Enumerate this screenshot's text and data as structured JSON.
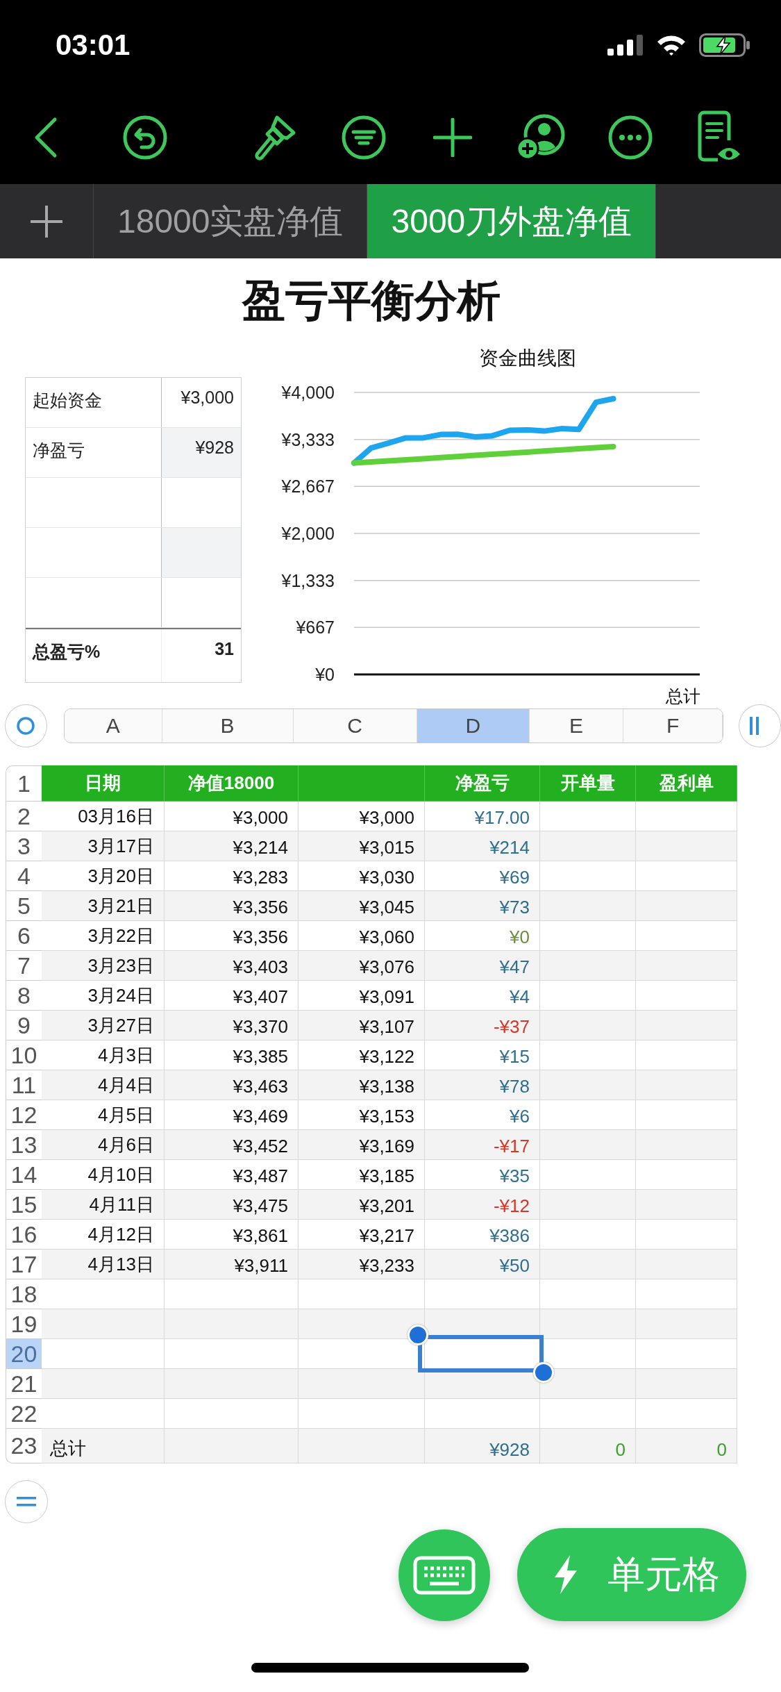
{
  "status_bar": {
    "time": "03:01"
  },
  "sheet_tabs": [
    {
      "label": "18000实盘净值",
      "selected": false
    },
    {
      "label": "3000刀外盘净值",
      "selected": true
    }
  ],
  "title": "盈亏平衡分析",
  "summary": {
    "rows": [
      {
        "label": "起始资金",
        "value": "¥3,000"
      },
      {
        "label": "净盈亏",
        "value": "¥928"
      }
    ],
    "total": {
      "label": "总盈亏%",
      "value": "31"
    }
  },
  "chart": {
    "chart_data": {
      "type": "line",
      "title": "资金曲线图",
      "xlabel": "总计",
      "grid": true,
      "ylim": [
        0,
        4000
      ],
      "yticks": [
        {
          "value": 0,
          "label": "¥0"
        },
        {
          "value": 667,
          "label": "¥667"
        },
        {
          "value": 1333,
          "label": "¥1,333"
        },
        {
          "value": 2000,
          "label": "¥2,000"
        },
        {
          "value": 2667,
          "label": "¥2,667"
        },
        {
          "value": 3333,
          "label": "¥3,333"
        },
        {
          "value": 4000,
          "label": "¥4,000"
        }
      ],
      "series": [
        {
          "color": "#1ea5f0",
          "values": [
            3000,
            3214,
            3283,
            3356,
            3356,
            3403,
            3407,
            3370,
            3385,
            3463,
            3469,
            3452,
            3487,
            3475,
            3861,
            3911,
            null,
            null,
            null,
            null,
            null
          ]
        },
        {
          "color": "#5fd03a",
          "values": [
            3000,
            3015,
            3030,
            3045,
            3060,
            3076,
            3091,
            3107,
            3122,
            3138,
            3153,
            3169,
            3185,
            3201,
            3217,
            3233,
            null,
            null,
            null,
            null,
            null
          ]
        }
      ]
    }
  },
  "sheet": {
    "columns": [
      {
        "label": "A",
        "selected": false,
        "header": "日期"
      },
      {
        "label": "B",
        "selected": false,
        "header": "净值18000"
      },
      {
        "label": "C",
        "selected": false
      },
      {
        "label": "D",
        "selected": true,
        "header": "净盈亏"
      },
      {
        "label": "E",
        "selected": false,
        "header": "开单量"
      },
      {
        "label": "F",
        "selected": false,
        "header": "盈利单"
      }
    ],
    "row_numbers": [
      {
        "label": "1",
        "selected": false
      },
      {
        "label": "2",
        "selected": false
      },
      {
        "label": "3",
        "selected": false
      },
      {
        "label": "4",
        "selected": false
      },
      {
        "label": "5",
        "selected": false
      },
      {
        "label": "6",
        "selected": false
      },
      {
        "label": "7",
        "selected": false
      },
      {
        "label": "8",
        "selected": false
      },
      {
        "label": "9",
        "selected": false
      },
      {
        "label": "10",
        "selected": false
      },
      {
        "label": "11",
        "selected": false
      },
      {
        "label": "12",
        "selected": false
      },
      {
        "label": "13",
        "selected": false
      },
      {
        "label": "14",
        "selected": false
      },
      {
        "label": "15",
        "selected": false
      },
      {
        "label": "16",
        "selected": false
      },
      {
        "label": "17",
        "selected": false
      },
      {
        "label": "18",
        "selected": false
      },
      {
        "label": "19",
        "selected": false
      },
      {
        "label": "20",
        "selected": true
      },
      {
        "label": "21",
        "selected": false
      },
      {
        "label": "22",
        "selected": false
      },
      {
        "label": "23",
        "selected": false
      }
    ],
    "rows": [
      {
        "date": "03月16日",
        "net": "¥3,000",
        "baseline": "¥3,000",
        "pnl": "¥17.00",
        "color": "#2e6e8e"
      },
      {
        "date": "3月17日",
        "net": "¥3,214",
        "baseline": "¥3,015",
        "pnl": "¥214",
        "color": "#2e6e8e"
      },
      {
        "date": "3月20日",
        "net": "¥3,283",
        "baseline": "¥3,030",
        "pnl": "¥69",
        "color": "#2e6e8e"
      },
      {
        "date": "3月21日",
        "net": "¥3,356",
        "baseline": "¥3,045",
        "pnl": "¥73",
        "color": "#2e6e8e"
      },
      {
        "date": "3月22日",
        "net": "¥3,356",
        "baseline": "¥3,060",
        "pnl": "¥0",
        "color": "#6b8f3c"
      },
      {
        "date": "3月23日",
        "net": "¥3,403",
        "baseline": "¥3,076",
        "pnl": "¥47",
        "color": "#2e6e8e"
      },
      {
        "date": "3月24日",
        "net": "¥3,407",
        "baseline": "¥3,091",
        "pnl": "¥4",
        "color": "#2e6e8e"
      },
      {
        "date": "3月27日",
        "net": "¥3,370",
        "baseline": "¥3,107",
        "pnl": "-¥37",
        "color": "#d6372a"
      },
      {
        "date": "4月3日",
        "net": "¥3,385",
        "baseline": "¥3,122",
        "pnl": "¥15",
        "color": "#2e6e8e"
      },
      {
        "date": "4月4日",
        "net": "¥3,463",
        "baseline": "¥3,138",
        "pnl": "¥78",
        "color": "#2e6e8e"
      },
      {
        "date": "4月5日",
        "net": "¥3,469",
        "baseline": "¥3,153",
        "pnl": "¥6",
        "color": "#2e6e8e"
      },
      {
        "date": "4月6日",
        "net": "¥3,452",
        "baseline": "¥3,169",
        "pnl": "-¥17",
        "color": "#d6372a"
      },
      {
        "date": "4月10日",
        "net": "¥3,487",
        "baseline": "¥3,185",
        "pnl": "¥35",
        "color": "#2e6e8e"
      },
      {
        "date": "4月11日",
        "net": "¥3,475",
        "baseline": "¥3,201",
        "pnl": "-¥12",
        "color": "#d6372a"
      },
      {
        "date": "4月12日",
        "net": "¥3,861",
        "baseline": "¥3,217",
        "pnl": "¥386",
        "color": "#2e6e8e"
      },
      {
        "date": "4月13日",
        "net": "¥3,911",
        "baseline": "¥3,233",
        "pnl": "¥50",
        "color": "#2e6e8e"
      }
    ],
    "total": {
      "label": "总计",
      "pnl": {
        "text": "¥928",
        "color": "#2e6e8e"
      },
      "orders": {
        "text": "0",
        "color": "#3aa12a"
      },
      "wins": {
        "text": "0",
        "color": "#3aa12a"
      }
    }
  },
  "actions": {
    "primary": "单元格"
  }
}
